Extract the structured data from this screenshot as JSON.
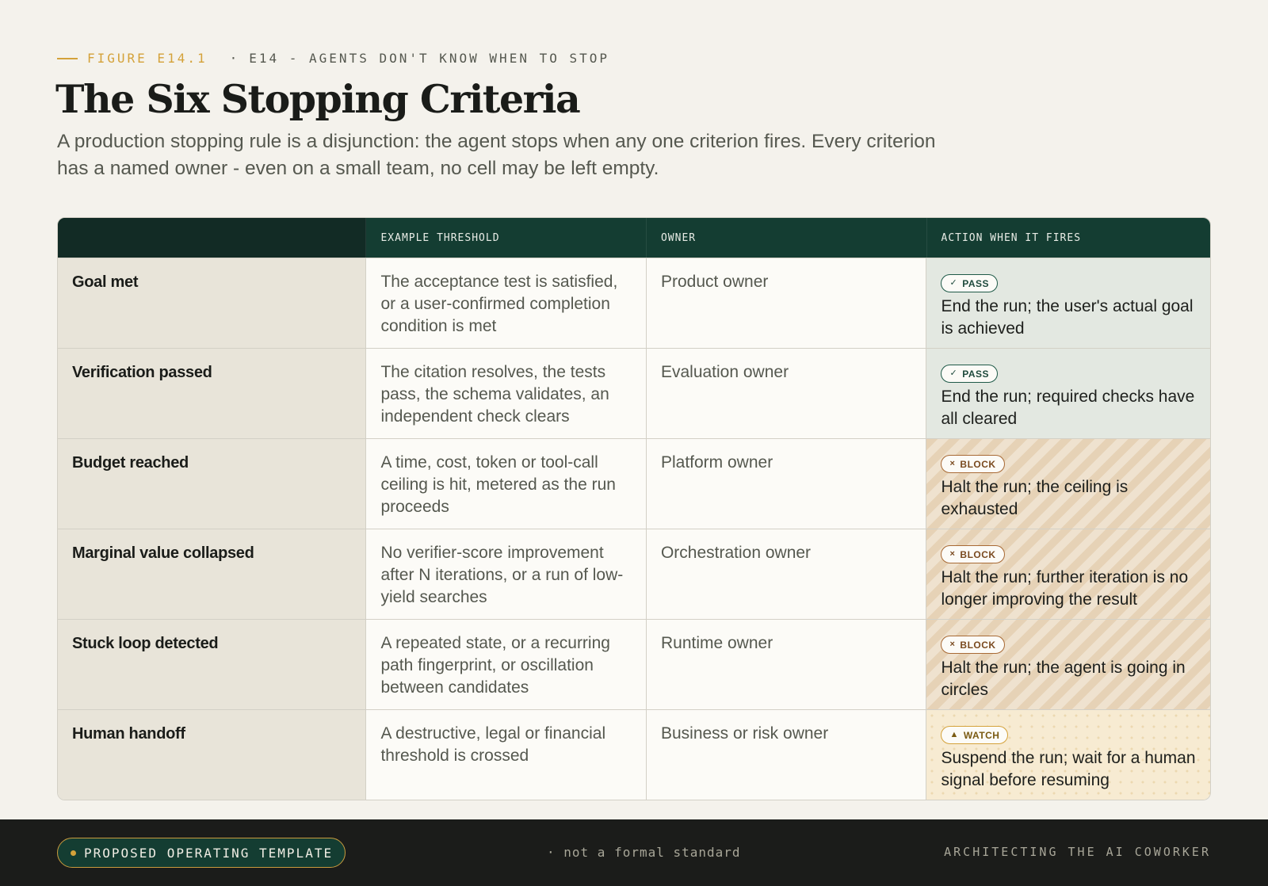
{
  "header": {
    "figure_label": "FIGURE E14.1",
    "separator": "·",
    "episode_label": "E14 - AGENTS DON'T KNOW WHEN TO STOP",
    "title": "The Six Stopping Criteria",
    "subtitle": "A production stopping rule is a disjunction: the agent stops when any one criterion fires. Every criterion has a named owner - even on a small team, no cell may be left empty."
  },
  "table": {
    "columns": [
      "",
      "EXAMPLE THRESHOLD",
      "OWNER",
      "ACTION WHEN IT FIRES"
    ],
    "rows": [
      {
        "criterion": "Goal met",
        "threshold": "The acceptance test is satisfied, or a user-confirmed completion condition is met",
        "owner": "Product owner",
        "badge": "PASS",
        "badge_icon": "✓",
        "kind": "pass",
        "action": "End the run; the user's actual goal is achieved"
      },
      {
        "criterion": "Verification passed",
        "threshold": "The citation resolves, the tests pass, the schema validates, an independent check clears",
        "owner": "Evaluation owner",
        "badge": "PASS",
        "badge_icon": "✓",
        "kind": "pass",
        "action": "End the run; required checks have all cleared"
      },
      {
        "criterion": "Budget reached",
        "threshold": "A time, cost, token or tool-call ceiling is hit, metered as the run proceeds",
        "owner": "Platform owner",
        "badge": "BLOCK",
        "badge_icon": "×",
        "kind": "block",
        "action": "Halt the run; the ceiling is exhausted"
      },
      {
        "criterion": "Marginal value collapsed",
        "threshold": "No verifier-score improvement after N iterations, or a run of low-yield searches",
        "owner": "Orchestration owner",
        "badge": "BLOCK",
        "badge_icon": "×",
        "kind": "block",
        "action": "Halt the run; further iteration is no longer improving the result"
      },
      {
        "criterion": "Stuck loop detected",
        "threshold": "A repeated state, or a recurring path fingerprint, or oscillation between candidates",
        "owner": "Runtime owner",
        "badge": "BLOCK",
        "badge_icon": "×",
        "kind": "block",
        "action": "Halt the run; the agent is going in circles"
      },
      {
        "criterion": "Human handoff",
        "threshold": "A destructive, legal or financial threshold is crossed",
        "owner": "Business or risk owner",
        "badge": "WATCH",
        "badge_icon": "▲",
        "kind": "watch",
        "action": "Suspend the run; wait for a human signal before resuming"
      }
    ]
  },
  "footer": {
    "pill_label": "PROPOSED OPERATING TEMPLATE",
    "middle": "· not a formal standard",
    "right": "ARCHITECTING THE AI COWORKER"
  },
  "colors": {
    "accent": "#d4a23a",
    "header_green": "#143d32",
    "pass": "#1f5a48",
    "block": "#a86a35",
    "watch": "#d4a23a"
  }
}
